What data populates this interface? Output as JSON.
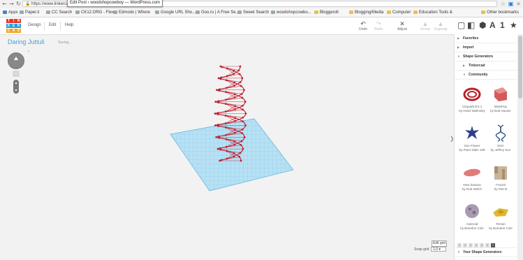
{
  "browser": {
    "url": "https://www.tinkercad.com/",
    "tooltip": "Edit Post ‹ woodshopcowboy — WordPress.com",
    "bookmarks": [
      {
        "label": "Apps",
        "icon": "apps-icon"
      },
      {
        "label": "Paper.li",
        "icon": "plus-icon"
      },
      {
        "label": "CC Search",
        "icon": "cc-icon"
      },
      {
        "label": "CK12.ORG - Flex...",
        "icon": "page-icon"
      },
      {
        "label": "Edmodo | Where",
        "icon": "edmodo-icon"
      },
      {
        "label": "Google URL Sho...",
        "icon": "google-icon"
      },
      {
        "label": "Goo.ru | A Free Se...",
        "icon": "gooru-icon"
      },
      {
        "label": "Sweet Search",
        "icon": "search-icon"
      },
      {
        "label": "woodshopcowbo...",
        "icon": "wordpress-icon"
      },
      {
        "label": "Bloggeroll",
        "icon": "folder-icon"
      },
      {
        "label": "Blogging/Media",
        "icon": "folder-icon"
      },
      {
        "label": "Computer",
        "icon": "folder-icon"
      },
      {
        "label": "Education Tools &",
        "icon": "folder-icon"
      }
    ],
    "other_bookmarks": "Other bookmarks"
  },
  "app": {
    "logo_letters": [
      "TIN",
      "KER",
      "CAD"
    ],
    "menu": [
      "Design",
      "Edit",
      "Help"
    ],
    "project_name": "Daring Juttuli",
    "status": "Saving...",
    "tools": [
      {
        "label": "Undo",
        "icon": "undo-icon",
        "enabled": true
      },
      {
        "label": "Redo",
        "icon": "redo-icon",
        "enabled": false
      },
      {
        "label": "Adjust",
        "icon": "adjust-icon",
        "enabled": true
      },
      {
        "label": "Group",
        "icon": "group-icon",
        "enabled": false
      },
      {
        "label": "Ungroup",
        "icon": "ungroup-icon",
        "enabled": false
      }
    ],
    "view_icons": [
      "cube-icon",
      "cube-shaded-icon",
      "sphere-icon",
      "letter-icon",
      "number-icon",
      "star-icon"
    ],
    "view_glyphs": [
      "▢",
      "◧",
      "⬢",
      "A",
      "1",
      "★"
    ],
    "edit_grid": "Edit grid",
    "snap_label": "Snap grid",
    "snap_value": "1.0"
  },
  "sidebar": {
    "sections": [
      {
        "label": "Favorites",
        "expanded": false
      },
      {
        "label": "Import",
        "expanded": false
      },
      {
        "label": "Shape Generators",
        "expanded": true
      },
      {
        "label": "Tinkercad",
        "expanded": false
      },
      {
        "label": "Community",
        "expanded": true
      }
    ],
    "shapes": [
      {
        "name": "CirquaRoll 5.1",
        "author": "by Heart Walmsley",
        "color": "#b8202a"
      },
      {
        "name": "MetaFloy",
        "author": "by Bob Hauser",
        "color": "#d45a5a"
      },
      {
        "name": "Sun Flower",
        "author": "by Peter Dlain 108",
        "color": "#2e3f8a"
      },
      {
        "name": "DNA",
        "author": "by Jeffrey Sun",
        "color": "#3a5a8a"
      },
      {
        "name": "New banana",
        "author": "by Rob Welch",
        "color": "#e07a7a"
      },
      {
        "name": "Fractal",
        "author": "by Petr B",
        "color": "#c8b49a"
      },
      {
        "name": "Asteroid",
        "author": "by Brandon Cole",
        "color": "#a89ab0"
      },
      {
        "name": "Terrain",
        "author": "by Brandon Cole",
        "color": "#e0b830"
      }
    ],
    "pager": [
      "1",
      "2",
      "3",
      "4",
      "5",
      "6",
      "7"
    ],
    "pager_active": "7",
    "bottom_section": "Your Shape Generators"
  }
}
